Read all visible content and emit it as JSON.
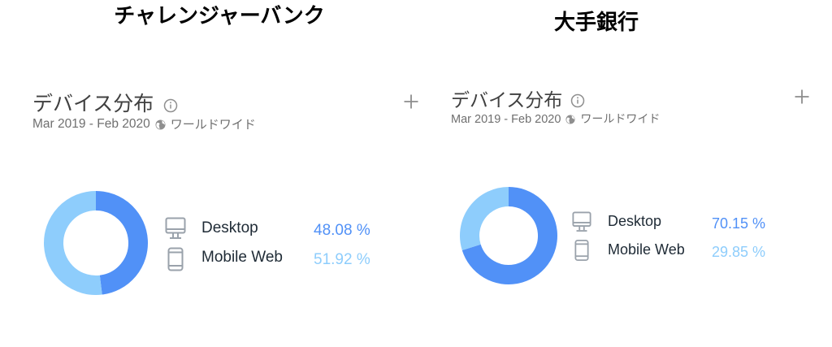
{
  "chart_data": [
    {
      "type": "pie",
      "donut": true,
      "heading": "チャレンジャーバンク",
      "title": "デバイス分布",
      "subtitle": "Mar 2019 - Feb 2020",
      "region": "ワールドワイド",
      "categories": [
        "Desktop",
        "Mobile Web"
      ],
      "values": [
        48.08,
        51.92
      ],
      "value_labels": [
        "48.08 %",
        "51.92 %"
      ],
      "colors": [
        "#5191f7",
        "#8ecdfc"
      ],
      "legend": "right",
      "legend_icons": [
        "desktop-icon",
        "mobile-icon"
      ]
    },
    {
      "type": "pie",
      "donut": true,
      "heading": "大手銀行",
      "title": "デバイス分布",
      "subtitle": "Mar 2019 - Feb 2020",
      "region": "ワールドワイド",
      "categories": [
        "Desktop",
        "Mobile Web"
      ],
      "values": [
        70.15,
        29.85
      ],
      "value_labels": [
        "70.15 %",
        "29.85 %"
      ],
      "colors": [
        "#5191f7",
        "#8ecdfc"
      ],
      "legend": "right",
      "legend_icons": [
        "desktop-icon",
        "mobile-icon"
      ]
    }
  ],
  "widget_icons": {
    "info": "info-icon",
    "add": "plus-icon",
    "region": "globe-icon"
  }
}
